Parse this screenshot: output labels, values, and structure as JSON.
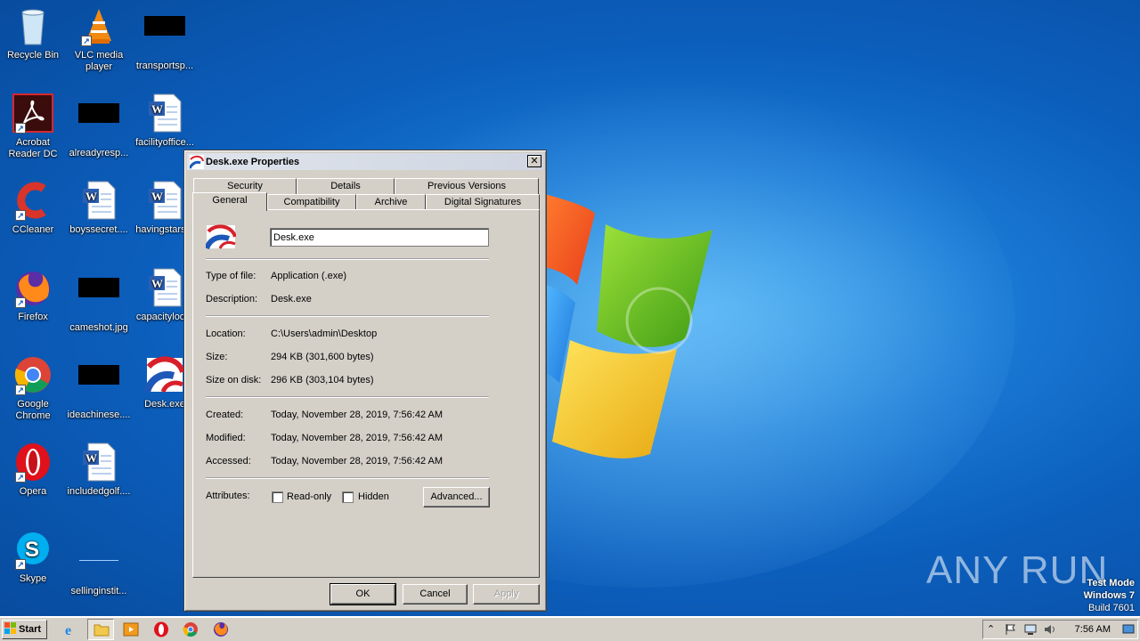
{
  "desktop": {
    "icons": [
      {
        "label": "Recycle Bin",
        "icon": "recycle-bin-icon"
      },
      {
        "label": "VLC media player",
        "icon": "vlc-icon"
      },
      {
        "label": "transportsp...",
        "icon": "black-thumbnail"
      },
      {
        "label": "Acrobat Reader DC",
        "icon": "acrobat-icon"
      },
      {
        "label": "alreadyresp...",
        "icon": "black-thumbnail"
      },
      {
        "label": "facilityoffice...",
        "icon": "word-document-icon"
      },
      {
        "label": "CCleaner",
        "icon": "ccleaner-icon"
      },
      {
        "label": "boyssecret....",
        "icon": "word-document-icon"
      },
      {
        "label": "havingstars...",
        "icon": "word-document-icon"
      },
      {
        "label": "Firefox",
        "icon": "firefox-icon"
      },
      {
        "label": "cameshot.jpg",
        "icon": "black-thumbnail"
      },
      {
        "label": "capacityloo...",
        "icon": "word-document-icon"
      },
      {
        "label": "Google Chrome",
        "icon": "chrome-icon"
      },
      {
        "label": "ideachinese....",
        "icon": "black-thumbnail"
      },
      {
        "label": "Desk.exe",
        "icon": "desk-exe-icon"
      },
      {
        "label": "Opera",
        "icon": "opera-icon"
      },
      {
        "label": "includedgolf....",
        "icon": "word-document-icon"
      },
      {
        "label": "Skype",
        "icon": "skype-icon"
      },
      {
        "label": "sellinginstit...",
        "icon": "blank-thumbnail"
      }
    ]
  },
  "dialog": {
    "title": "Desk.exe Properties",
    "close_glyph": "✕",
    "tabs_row1": [
      "Security",
      "Details",
      "Previous Versions"
    ],
    "tabs_row2": [
      "General",
      "Compatibility",
      "Archive",
      "Digital Signatures"
    ],
    "active_tab": "General",
    "file_name": "Desk.exe",
    "type_label": "Type of file:",
    "type_value": "Application (.exe)",
    "description_label": "Description:",
    "description_value": "Desk.exe",
    "location_label": "Location:",
    "location_value": "C:\\Users\\admin\\Desktop",
    "size_label": "Size:",
    "size_value": "294 KB (301,600 bytes)",
    "size_on_disk_label": "Size on disk:",
    "size_on_disk_value": "296 KB (303,104 bytes)",
    "created_label": "Created:",
    "created_value": "Today, November 28, 2019, 7:56:42 AM",
    "modified_label": "Modified:",
    "modified_value": "Today, November 28, 2019, 7:56:42 AM",
    "accessed_label": "Accessed:",
    "accessed_value": "Today, November 28, 2019, 7:56:42 AM",
    "attributes_label": "Attributes:",
    "readonly_label": "Read-only",
    "readonly_checked": false,
    "hidden_label": "Hidden",
    "hidden_checked": false,
    "advanced_label": "Advanced...",
    "ok_label": "OK",
    "cancel_label": "Cancel",
    "apply_label": "Apply"
  },
  "taskbar": {
    "start_label": "Start",
    "pinned": [
      "internet-explorer-icon",
      "explorer-folder-icon",
      "media-player-icon",
      "opera-icon",
      "chrome-icon",
      "firefox-icon"
    ],
    "clock": "7:56 AM"
  },
  "watermark": {
    "brand": "ANY RUN",
    "line1": "Test Mode",
    "line2": "Windows 7",
    "line3": "Build 7601"
  },
  "colors": {
    "desktop_blue": "#0c5fbd",
    "dialog_face": "#d4d0c8"
  }
}
